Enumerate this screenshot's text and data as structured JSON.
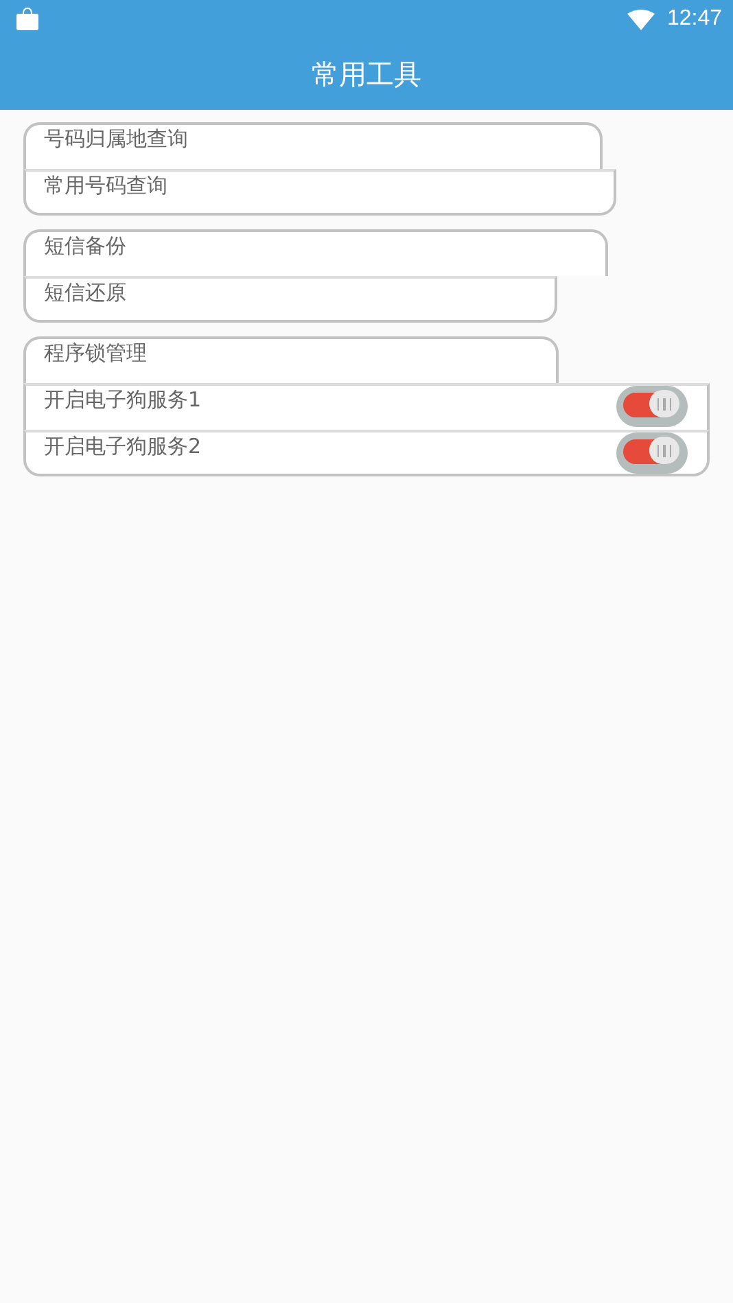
{
  "status_bar": {
    "time": "12:47"
  },
  "app_bar": {
    "title": "常用工具"
  },
  "groups": [
    {
      "rows": [
        {
          "kind": "text",
          "label": "号码归属地查询"
        },
        {
          "kind": "text",
          "label": "常用号码查询"
        }
      ]
    },
    {
      "rows": [
        {
          "kind": "text",
          "label": "短信备份"
        },
        {
          "kind": "text",
          "label": "短信还原"
        }
      ]
    },
    {
      "rows": [
        {
          "kind": "text",
          "label": "程序锁管理"
        },
        {
          "kind": "toggle",
          "label": "开启电子狗服务1",
          "on": true
        },
        {
          "kind": "toggle",
          "label": "开启电子狗服务2",
          "on": true
        }
      ]
    }
  ]
}
